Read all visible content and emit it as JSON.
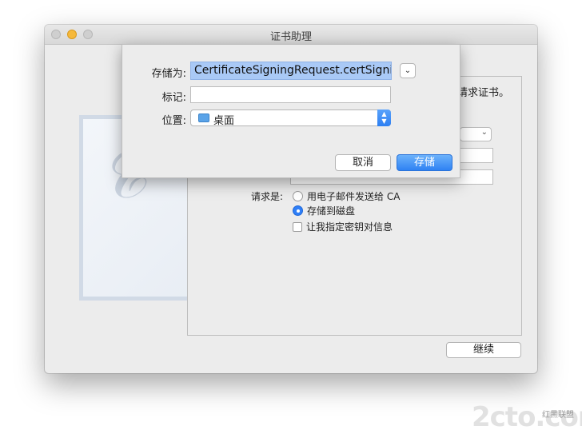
{
  "window": {
    "title": "证书助理"
  },
  "panel": {
    "intro_fragment": "请求证书。",
    "request_label": "请求是:",
    "options": [
      {
        "label": "用电子邮件发送给 CA",
        "selected": false
      },
      {
        "label": "存储到磁盘",
        "selected": true
      }
    ],
    "let_me_specify": "让我指定密钥对信息",
    "continue_label": "继续"
  },
  "sheet": {
    "save_as_label": "存储为:",
    "save_as_value": "CertificateSigningRequest.certSigningR",
    "tags_label": "标记:",
    "tags_value": "",
    "where_label": "位置:",
    "where_value": "桌面",
    "cancel_label": "取消",
    "save_label": "存储"
  },
  "icons": {
    "expand": "chevron-down-icon",
    "folder": "folder-icon",
    "stepper": "up-down-stepper-icon"
  },
  "colors": {
    "accent": "#2f82f3",
    "selection": "#a9c9f6"
  },
  "watermark": {
    "text": "2cto.com",
    "sub": "红黑联盟"
  }
}
